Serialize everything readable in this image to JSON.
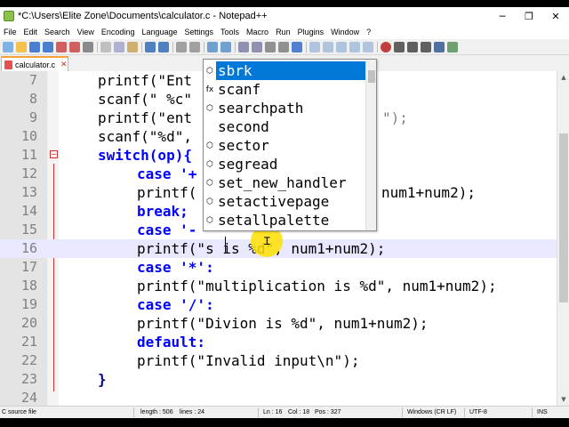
{
  "window": {
    "title": "*C:\\Users\\Elite Zone\\Documents\\calculator.c - Notepad++",
    "controls": {
      "minimize": "─",
      "maximize": "❐",
      "close": "✕"
    }
  },
  "menu": [
    "File",
    "Edit",
    "Search",
    "View",
    "Encoding",
    "Language",
    "Settings",
    "Tools",
    "Macro",
    "Run",
    "Plugins",
    "Window",
    "?"
  ],
  "tab": {
    "label": "calculator.c",
    "close": "✕"
  },
  "editor": {
    "lines": [
      {
        "no": "7",
        "text": "printf(\"Ent"
      },
      {
        "no": "8",
        "text": "scanf(\" %c\""
      },
      {
        "no": "9",
        "text": "printf(\"ent"
      },
      {
        "no": "10",
        "text": "scanf(\"%d\","
      },
      {
        "no": "11",
        "text": "switch(op){"
      },
      {
        "no": "12",
        "text": "case '+"
      },
      {
        "no": "13",
        "text": "printf("
      },
      {
        "no": "14",
        "text": "break;"
      },
      {
        "no": "15",
        "text": "case '-"
      },
      {
        "no": "16",
        "text": "printf(\"s is %d\", num1+num2);"
      },
      {
        "no": "17",
        "text": "case '*':"
      },
      {
        "no": "18",
        "text": "printf(\"multiplication is %d\", num1+num2);"
      },
      {
        "no": "19",
        "text": "case '/':"
      },
      {
        "no": "20",
        "text": "printf(\"Divion is %d\", num1+num2);"
      },
      {
        "no": "21",
        "text": "default:"
      },
      {
        "no": "22",
        "text": "printf(\"Invalid input\\n\");"
      },
      {
        "no": "23",
        "text": "}"
      },
      {
        "no": "24",
        "text": ""
      }
    ],
    "line9_tail": "\");",
    "line13_tail": "num1+num2);"
  },
  "autocomplete": {
    "items": [
      {
        "icon": "⬡",
        "label": "sbrk",
        "selected": true
      },
      {
        "icon": "fx",
        "label": "scanf"
      },
      {
        "icon": "⬡",
        "label": "searchpath"
      },
      {
        "icon": "",
        "label": "second"
      },
      {
        "icon": "⬡",
        "label": "sector"
      },
      {
        "icon": "⬡",
        "label": "segread"
      },
      {
        "icon": "⬡",
        "label": "set_new_handler"
      },
      {
        "icon": "⬡",
        "label": "setactivepage"
      },
      {
        "icon": "⬡",
        "label": "setallpalette"
      }
    ]
  },
  "status": {
    "type": "C source file",
    "length": "length : 506",
    "lines": "lines : 24",
    "ln": "Ln : 16",
    "col": "Col : 18",
    "pos": "Pos : 327",
    "eol": "Windows (CR LF)",
    "encoding": "UTF-8",
    "mode": "INS"
  },
  "colors": {
    "keyword": "#0000ff",
    "string": "#808080",
    "selection": "#0078d7",
    "tab_accent": "#f7a13b",
    "cursor_highlight": "#ffe000"
  }
}
